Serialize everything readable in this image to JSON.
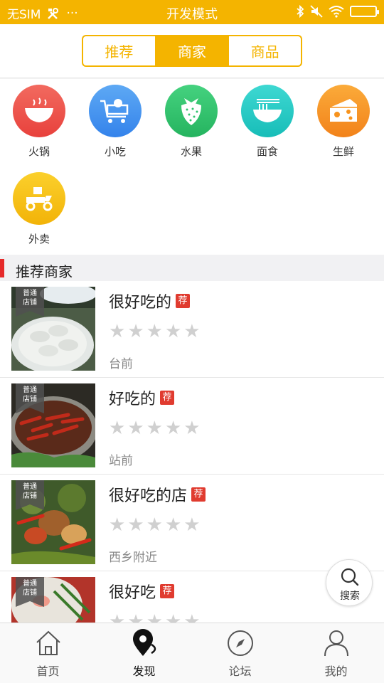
{
  "status_bar": {
    "carrier": "无SIM",
    "dots": "···",
    "title": "开发模式"
  },
  "segment": {
    "tabs": [
      "推荐",
      "商家",
      "商品"
    ],
    "active_index": 1
  },
  "categories": [
    {
      "label": "火锅",
      "icon": "hotpot-bowl-icon",
      "color": "#ee4c47"
    },
    {
      "label": "小吃",
      "icon": "snack-cart-icon",
      "color": "#3d8ff0"
    },
    {
      "label": "水果",
      "icon": "strawberry-icon",
      "color": "#2fc56d"
    },
    {
      "label": "面食",
      "icon": "noodle-bowl-icon",
      "color": "#22c9c4"
    },
    {
      "label": "生鲜",
      "icon": "cheese-icon",
      "color": "#f7931d"
    },
    {
      "label": "外卖",
      "icon": "scooter-icon",
      "color": "#f5bf13"
    }
  ],
  "section": {
    "title": "推荐商家"
  },
  "merchants": [
    {
      "badge_line1": "普通",
      "badge_line2": "店铺",
      "name": "很好吃的",
      "rec": "荐",
      "location": "台前",
      "rating": 0
    },
    {
      "badge_line1": "普通",
      "badge_line2": "店铺",
      "name": "好吃的",
      "rec": "荐",
      "location": "站前",
      "rating": 0
    },
    {
      "badge_line1": "普通",
      "badge_line2": "店铺",
      "name": "很好吃的店",
      "rec": "荐",
      "location": "西乡附近",
      "rating": 0
    },
    {
      "badge_line1": "普通",
      "badge_line2": "店铺",
      "name": "很好吃",
      "rec": "荐",
      "location": "",
      "rating": 0
    }
  ],
  "search_fab": {
    "label": "搜索"
  },
  "tab_bar": {
    "tabs": [
      {
        "label": "首页",
        "icon": "home-icon"
      },
      {
        "label": "发现",
        "icon": "discover-pin-icon"
      },
      {
        "label": "论坛",
        "icon": "compass-icon"
      },
      {
        "label": "我的",
        "icon": "person-icon"
      }
    ],
    "active_index": 1
  },
  "colors": {
    "accent": "#f4b400",
    "rec_badge": "#e03b2f",
    "section_bar": "#e62a2a"
  }
}
